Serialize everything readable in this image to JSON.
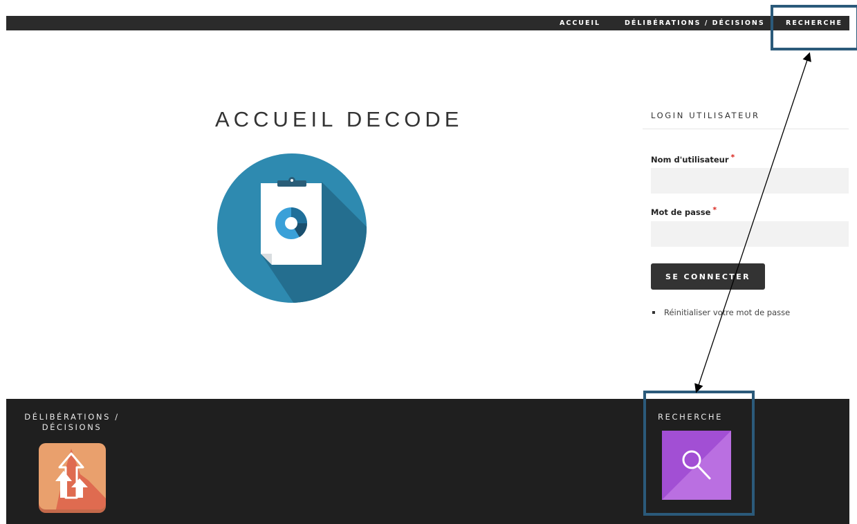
{
  "nav": {
    "items": [
      {
        "label": "ACCUEIL"
      },
      {
        "label": "DÉLIBÉRATIONS / DÉCISIONS"
      },
      {
        "label": "RECHERCHE"
      }
    ]
  },
  "main": {
    "title": "ACCUEIL DECODE",
    "illustration_icon": "clipboard-donut-chart-icon"
  },
  "login": {
    "heading": "LOGIN UTILISATEUR",
    "username_label": "Nom d'utilisateur",
    "password_label": "Mot de passe",
    "required_mark": "*",
    "username_value": "",
    "password_value": "",
    "submit_label": "SE CONNECTER",
    "reset_link": "Réinitialiser votre mot de passe"
  },
  "footer": {
    "deliberations_heading_line1": "DÉLIBÉRATIONS /",
    "deliberations_heading_line2": "DÉCISIONS",
    "deliberations_icon": "upload-arrows-icon",
    "search_heading": "RECHERCHE",
    "search_icon": "magnifier-icon"
  },
  "colors": {
    "nav_bg": "#2b2b2b",
    "footer_bg": "#1f1f1f",
    "hero_circle": "#2e8ab0",
    "button_bg": "#333333",
    "required": "#d9251d",
    "deliberations_tile": "#e9a06d",
    "search_tile": "#a24fd4",
    "annotation": "#2b5a7a"
  }
}
